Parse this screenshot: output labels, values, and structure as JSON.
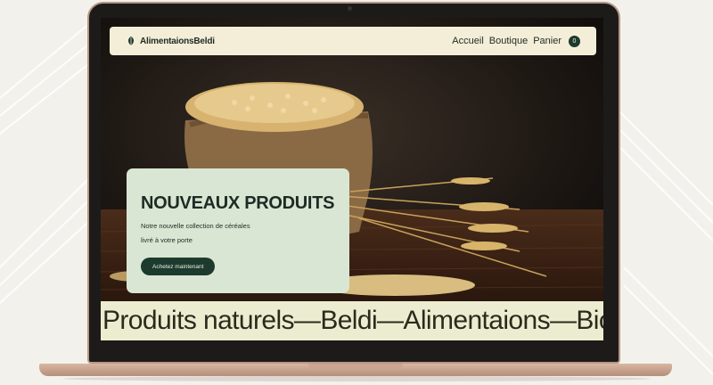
{
  "navbar": {
    "brand": "AlimentaionsBeldi",
    "links": [
      "Accueil",
      "Boutique",
      "Panier"
    ],
    "cart_count": "0"
  },
  "hero": {
    "title": "NOUVEAUX PRODUITS",
    "subtitle_line1": "Notre nouvelle collection de céréales",
    "subtitle_line2": "livré à votre porte",
    "cta": "Achetez maintenant"
  },
  "marquee": {
    "text": "Produits naturels—Beldi—Alimentaions—Bio"
  },
  "colors": {
    "navbar_bg": "#f4eed9",
    "card_bg": "#d9e6d3",
    "accent": "#1d3a2e",
    "marquee_bg": "#ecedd0",
    "laptop_body": "#b89684"
  }
}
